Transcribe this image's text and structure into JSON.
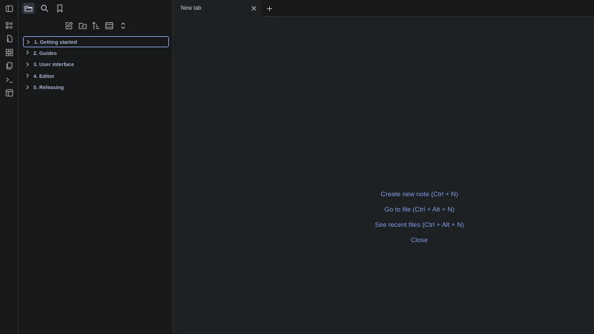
{
  "ribbon": {
    "items": [
      {
        "icon": "sidebar-toggle-icon"
      },
      {
        "icon": "list-icon"
      },
      {
        "icon": "file-copy-icon"
      },
      {
        "icon": "grid-icon"
      },
      {
        "icon": "files-icon"
      },
      {
        "icon": "terminal-icon"
      },
      {
        "icon": "layout-icon"
      }
    ]
  },
  "sidebar": {
    "header_icons": [
      "folder-icon",
      "search-icon",
      "bookmark-icon"
    ],
    "nav_actions": [
      "new-note-icon",
      "new-folder-icon",
      "sort-icon",
      "collapse-icon",
      "expand-icon"
    ],
    "tree": [
      {
        "label": "1. Getting started"
      },
      {
        "label": "2. Guides"
      },
      {
        "label": "3. User interface"
      },
      {
        "label": "4. Editor"
      },
      {
        "label": "5. Releasing"
      }
    ]
  },
  "tabs": [
    {
      "title": "New tab"
    }
  ],
  "main": {
    "actions": [
      {
        "label": "Create new note (Ctrl + N)"
      },
      {
        "label": "Go to file (Ctrl + Alt + N)"
      },
      {
        "label": "See recent files (Ctrl + Alt + N)"
      },
      {
        "label": "Close"
      }
    ]
  },
  "colors": {
    "background": "#1e2124",
    "sidebar": "#161819",
    "accent": "#7f9be0",
    "tree_text": "#a6b0cc"
  }
}
